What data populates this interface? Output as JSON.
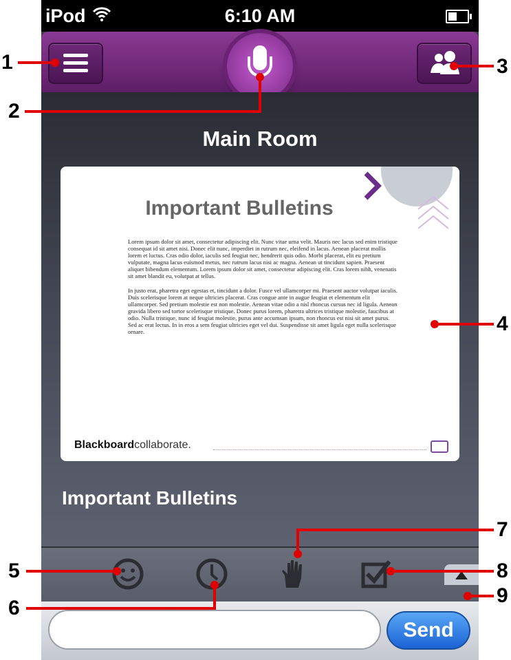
{
  "status_bar": {
    "carrier": "iPod",
    "time": "6:10 AM"
  },
  "header": {
    "mic_state": "active"
  },
  "room": {
    "title": "Main Room"
  },
  "slide": {
    "title": "Important Bulletins",
    "paragraph_1": "Lorem ipsum dolor sit amet, consectetur adipiscing elit. Nunc vitae urna velit. Mauris nec lacus sed enim tristique consequat id sit amet nisi. Donec elit nunc, imperdiet in rutrum nec, eleifend in lacus. Aenean placerat mollis lorem et luctus. Cras odio dolor, iaculis sed feugiat nec, hendrerit quis odio. Morbi placerat, elit eu pretium vulputate, magna lacus euismod metus, nec rutrum lacus nisi ac magna. Aenean ut tincidunt sapien. Praesent aliquet bibendum elementum. Lorem ipsum dolor sit amet, consectetur adipiscing elit. Cras lorem nibh, venenatis sit amet blandit eu, volutpat at tellus.",
    "paragraph_2": "In justo erat, pharetra eget egestas et, tincidunt a dolor. Fusce vel ullamcorper mi. Praesent auctor volutpat iaculis. Duis scelerisque lorem at neque ultricies placerat. Cras congue ante in augue feugiat et elementum elit ullamcorper. Sed pretium molestie est non molestie. Aenean vitae odio a nisl rhoncus cursus nec id ligula. Aenean gravida libero sed tortor scelerisque tristique. Donec purus lorem, pharetra ultrices tristique molestie, faucibus at odio. Nulla tristique, nunc id feugiat molestie, purus ante accumsan ipsum, non rhoncus est nisi sit amet purus. Sed ac erat lectus. In in eros a sem feugiat ultricies eget vel dui. Suspendisse sit amet ligula eget nulla scelerisque ornare.",
    "brand_bold": "Blackboard",
    "brand_light": "collaborate."
  },
  "document_name": "Important Bulletins",
  "toolbar": {
    "icons": [
      "emoticon-icon",
      "clock-icon",
      "raise-hand-icon",
      "poll-checkbox-icon"
    ]
  },
  "chat": {
    "input_value": "",
    "send_label": "Send"
  },
  "callouts": [
    "1",
    "2",
    "3",
    "4",
    "5",
    "6",
    "7",
    "8",
    "9"
  ],
  "colors": {
    "header_purple": "#7a2f84",
    "send_blue": "#1a63d6",
    "callout_red": "#e00000",
    "background_dark": "#3a3d47"
  }
}
